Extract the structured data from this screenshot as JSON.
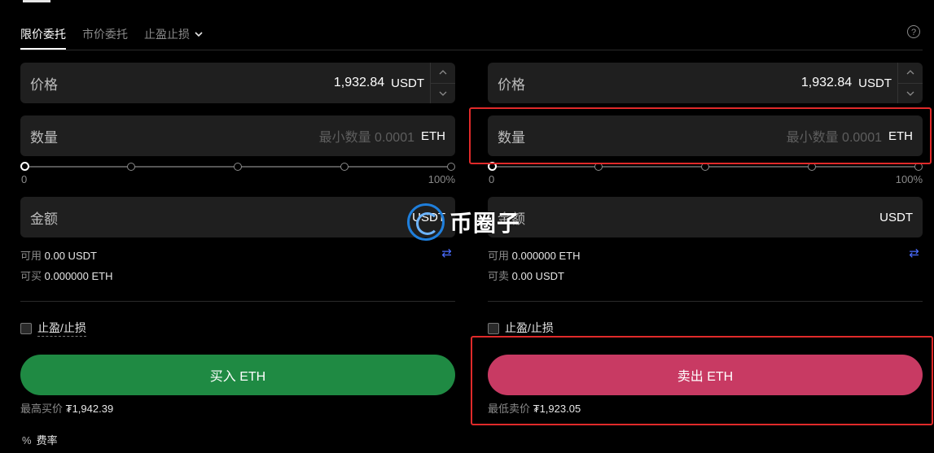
{
  "tabs": [
    {
      "label": "限价委托",
      "active": true
    },
    {
      "label": "市价委托",
      "active": false
    },
    {
      "label": "止盈止损",
      "active": false
    }
  ],
  "icons": {
    "help": "?",
    "chevron": "chevron-down-icon",
    "swap": "⇄",
    "percent": "%"
  },
  "buy": {
    "price_label": "价格",
    "price_value": "1,932.84",
    "price_unit": "USDT",
    "qty_label": "数量",
    "qty_placeholder": "最小数量 0.0001",
    "qty_unit": "ETH",
    "slider_min": "0",
    "slider_max": "100%",
    "slider_value_pct": 0,
    "amount_label": "金额",
    "amount_unit": "USDT",
    "avail_label1": "可用",
    "avail_value1": "0.00 USDT",
    "avail_label2": "可买",
    "avail_value2": "0.000000 ETH",
    "tpsl_label": "止盈/止损",
    "action_label": "买入 ETH",
    "best_label": "最高买价",
    "best_value": "₮1,942.39"
  },
  "sell": {
    "price_label": "价格",
    "price_value": "1,932.84",
    "price_unit": "USDT",
    "qty_label": "数量",
    "qty_placeholder": "最小数量 0.0001",
    "qty_unit": "ETH",
    "slider_min": "0",
    "slider_max": "100%",
    "slider_value_pct": 0,
    "amount_label": "金额",
    "amount_unit": "USDT",
    "avail_label1": "可用",
    "avail_value1": "0.000000 ETH",
    "avail_label2": "可卖",
    "avail_value2": "0.00 USDT",
    "tpsl_label": "止盈/止损",
    "action_label": "卖出 ETH",
    "best_label": "最低卖价",
    "best_value": "₮1,923.05"
  },
  "fee_label": "费率",
  "watermark_text": "币圈子",
  "colors": {
    "buy": "#1f8a43",
    "sell": "#c83a63",
    "highlight": "#e02a2a",
    "swap": "#4a6cff"
  }
}
